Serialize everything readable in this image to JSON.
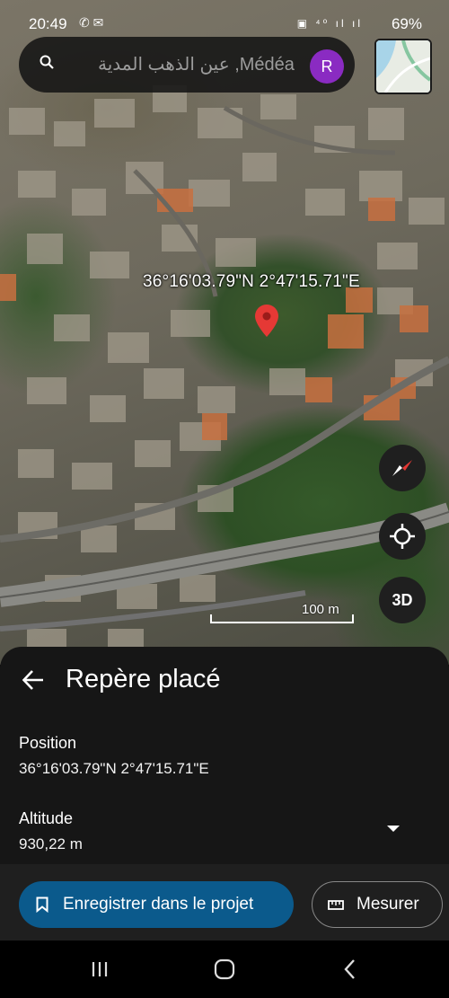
{
  "status_bar": {
    "time": "20:49",
    "left_icons": "✆ ✉",
    "right_icons": "▣ ⁴⁰ ıl ıl",
    "battery": "69%"
  },
  "search": {
    "text": "عين الذهب المدية ,Médéa",
    "avatar_letter": "R"
  },
  "map": {
    "coordinate_label": "36°16'03.79\"N 2°47'15.71\"E",
    "scale_label": "100 m",
    "view_3d_label": "3D"
  },
  "sheet": {
    "title": "Repère placé",
    "position_label": "Position",
    "position_value": "36°16'03.79\"N 2°47'15.71\"E",
    "altitude_label": "Altitude",
    "altitude_value": "930,22 m"
  },
  "actions": {
    "save_label": "Enregistrer dans le projet",
    "measure_label": "Mesurer"
  },
  "colors": {
    "sheet_bg": "#161616",
    "primary_button": "#0b5a8c",
    "avatar": "#8a2bc2",
    "pin": "#e53935"
  }
}
